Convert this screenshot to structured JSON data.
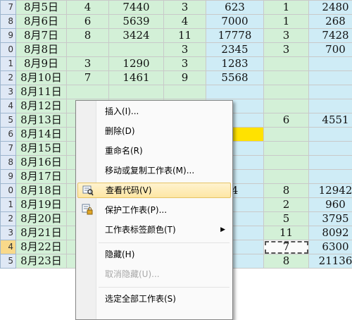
{
  "sheet": {
    "rows": [
      {
        "rownum": "7",
        "date": "8月5日",
        "c1": "4",
        "c2": "7440",
        "c3": "3",
        "c4": "623",
        "c5": "1",
        "c6": "2480"
      },
      {
        "rownum": "8",
        "date": "8月6日",
        "c1": "6",
        "c2": "5639",
        "c3": "4",
        "c4": "7000",
        "c5": "1",
        "c6": "268"
      },
      {
        "rownum": "9",
        "date": "8月7日",
        "c1": "8",
        "c2": "3424",
        "c3": "11",
        "c4": "17778",
        "c5": "3",
        "c6": "7428"
      },
      {
        "rownum": "0",
        "date": "8月8日",
        "c1": "",
        "c2": "",
        "c3": "3",
        "c4": "2345",
        "c5": "3",
        "c6": "700"
      },
      {
        "rownum": "1",
        "date": "8月9日",
        "c1": "3",
        "c2": "1290",
        "c3": "3",
        "c4": "1283",
        "c5": "",
        "c6": ""
      },
      {
        "rownum": "2",
        "date": "8月10日",
        "c1": "7",
        "c2": "1461",
        "c3": "9",
        "c4": "5568",
        "c5": "",
        "c6": ""
      },
      {
        "rownum": "3",
        "date": "8月11日",
        "c1": "",
        "c2": "",
        "c3": "",
        "c4": "",
        "c5": "",
        "c6": ""
      },
      {
        "rownum": "4",
        "date": "8月12日",
        "c1": "",
        "c2": "",
        "c3": "",
        "c4": "",
        "c5": "",
        "c6": ""
      },
      {
        "rownum": "5",
        "date": "8月13日",
        "c1": "",
        "c2": "",
        "c3": "",
        "c4": "",
        "c5": "6",
        "c6": "4551"
      },
      {
        "rownum": "6",
        "date": "8月14日",
        "c1": "",
        "c2": "",
        "c3": "",
        "c4": "",
        "c5": "",
        "c6": ""
      },
      {
        "rownum": "7",
        "date": "8月15日",
        "c1": "",
        "c2": "",
        "c3": "",
        "c4": "",
        "c5": "",
        "c6": ""
      },
      {
        "rownum": "8",
        "date": "8月16日",
        "c1": "",
        "c2": "",
        "c3": "",
        "c4": "",
        "c5": "",
        "c6": ""
      },
      {
        "rownum": "9",
        "date": "8月17日",
        "c1": "",
        "c2": "",
        "c3": "",
        "c4": "",
        "c5": "",
        "c6": ""
      },
      {
        "rownum": "0",
        "date": "8月18日",
        "c1": "",
        "c2": "",
        "c3": "",
        "c4": "4",
        "c5": "8",
        "c6": "12942"
      },
      {
        "rownum": "1",
        "date": "8月19日",
        "c1": "",
        "c2": "",
        "c3": "",
        "c4": "",
        "c5": "2",
        "c6": "960"
      },
      {
        "rownum": "2",
        "date": "8月20日",
        "c1": "",
        "c2": "",
        "c3": "",
        "c4": "",
        "c5": "5",
        "c6": "3795"
      },
      {
        "rownum": "3",
        "date": "8月21日",
        "c1": "",
        "c2": "",
        "c3": "",
        "c4": "",
        "c5": "11",
        "c6": "8092"
      },
      {
        "rownum": "4",
        "date": "8月22日",
        "c1": "",
        "c2": "",
        "c3": "",
        "c4": "",
        "c5": "7",
        "c6": "6300"
      },
      {
        "rownum": "5",
        "date": "8月23日",
        "c1": "",
        "c2": "",
        "c3": "",
        "c4": "",
        "c5": "8",
        "c6": "21136"
      }
    ]
  },
  "context_menu": {
    "items": [
      {
        "label": "插入(I)...",
        "icon": "",
        "disabled": false,
        "hover": false,
        "submenu": false
      },
      {
        "label": "删除(D)",
        "icon": "",
        "disabled": false,
        "hover": false,
        "submenu": false
      },
      {
        "label": "重命名(R)",
        "icon": "",
        "disabled": false,
        "hover": false,
        "submenu": false
      },
      {
        "label": "移动或复制工作表(M)...",
        "icon": "",
        "disabled": false,
        "hover": false,
        "submenu": false
      },
      {
        "label": "查看代码(V)",
        "icon": "view-code-icon",
        "disabled": false,
        "hover": true,
        "submenu": false
      },
      {
        "label": "保护工作表(P)...",
        "icon": "protect-sheet-icon",
        "disabled": false,
        "hover": false,
        "submenu": false
      },
      {
        "label": "工作表标签颜色(T)",
        "icon": "",
        "disabled": false,
        "hover": false,
        "submenu": true
      },
      {
        "label": "隐藏(H)",
        "icon": "",
        "disabled": false,
        "hover": false,
        "submenu": false
      },
      {
        "label": "取消隐藏(U)...",
        "icon": "",
        "disabled": true,
        "hover": false,
        "submenu": false
      },
      {
        "label": "选定全部工作表(S)",
        "icon": "",
        "disabled": false,
        "hover": false,
        "submenu": false
      }
    ],
    "submenu_arrow": "▶"
  },
  "colors": {
    "green_fill": "#d3f0d7",
    "blue_fill": "#cfecf6",
    "highlight_yellow": "#ffe200",
    "menu_hover": "#fde6a4"
  }
}
